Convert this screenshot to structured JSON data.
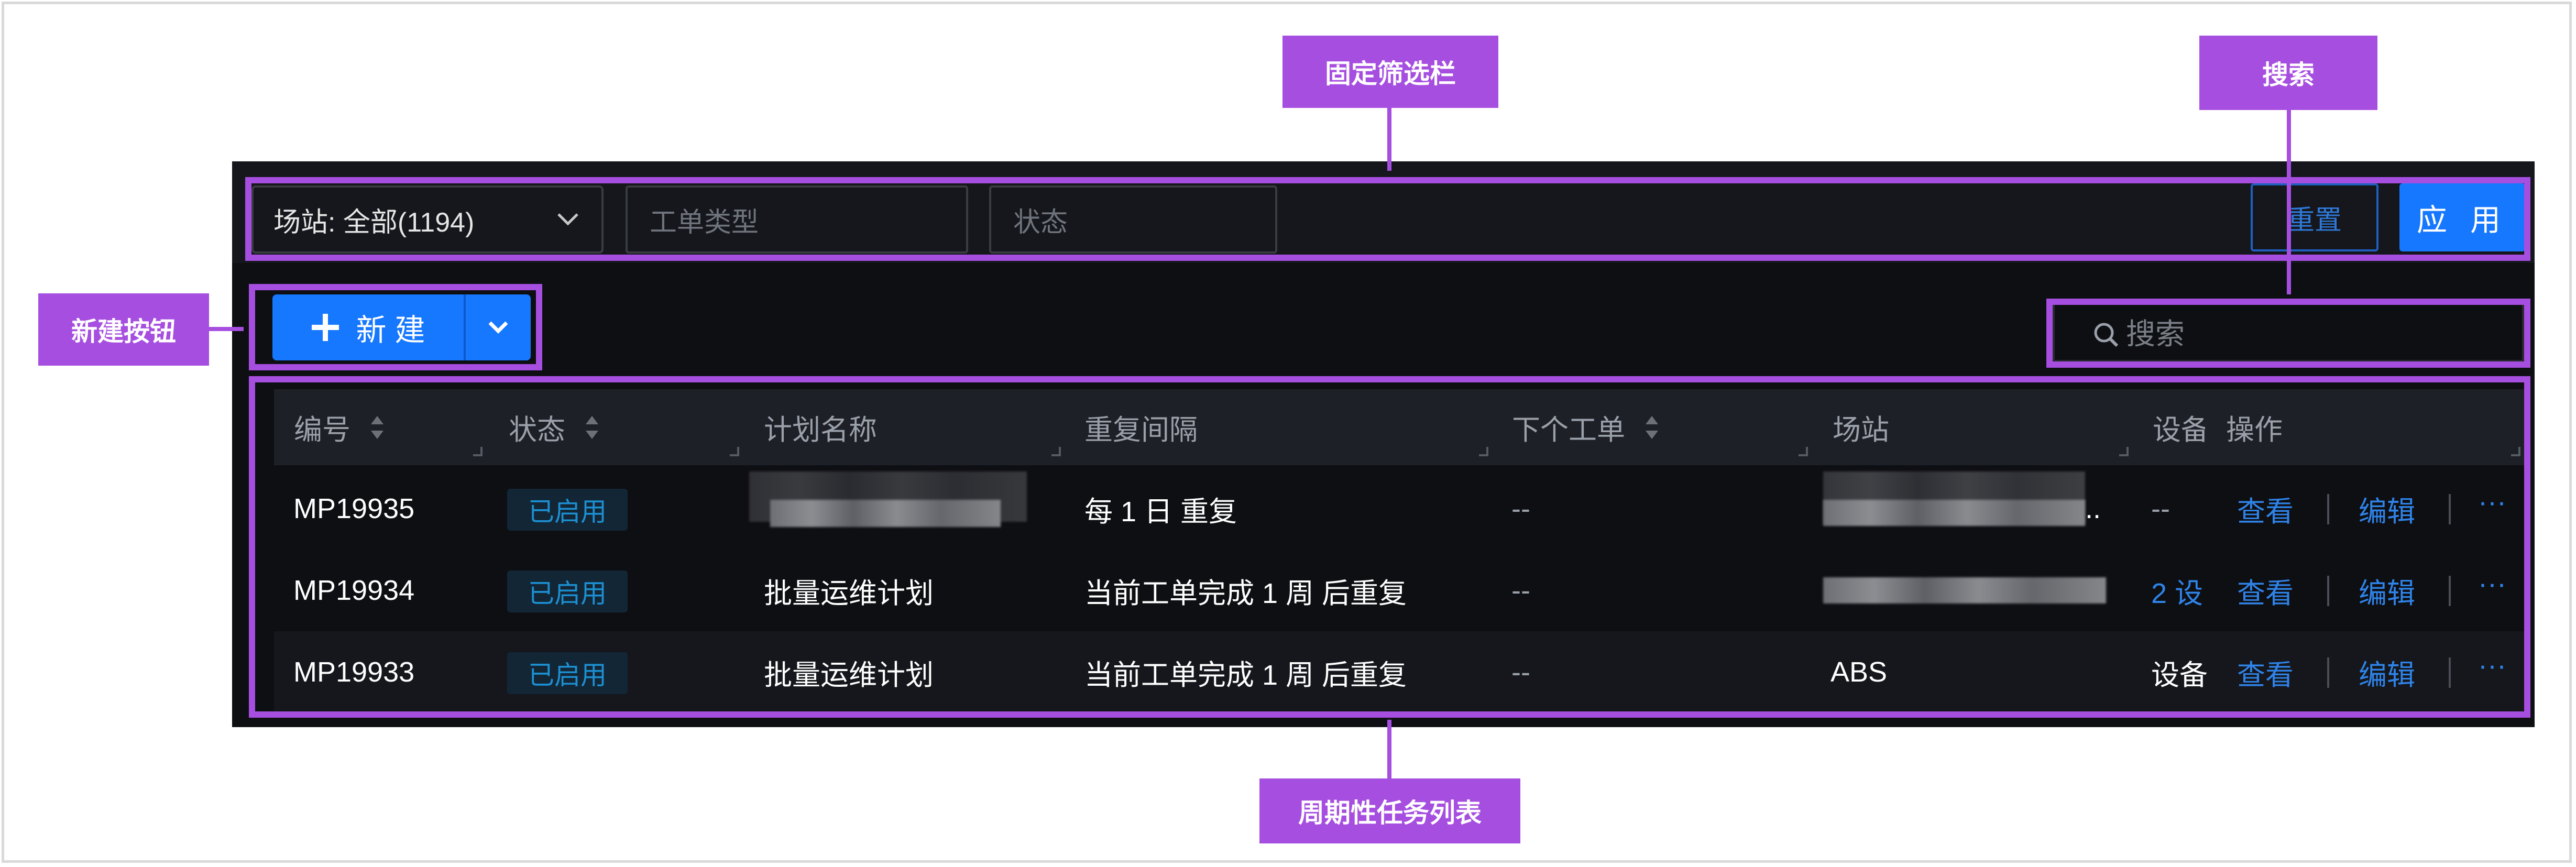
{
  "filter": {
    "site_select": "场站: 全部(1194)",
    "work_order_type_placeholder": "工单类型",
    "status_placeholder": "状态",
    "reset_label": "重置",
    "apply_label": "应 用"
  },
  "toolbar": {
    "new_label": "新 建",
    "search_placeholder": "搜索"
  },
  "table": {
    "columns": [
      "编号",
      "状态",
      "计划名称",
      "重复间隔",
      "下个工单",
      "场站",
      "设备",
      "操作"
    ],
    "rows": [
      {
        "id": "MP19935",
        "status": "已启用",
        "name": "",
        "repeat": "每 1 日 重复",
        "next": "--",
        "site": "",
        "device": "--"
      },
      {
        "id": "MP19934",
        "status": "已启用",
        "name": "批量运维计划",
        "repeat": "当前工单完成 1 周 后重复",
        "next": "--",
        "site": "",
        "device": "2 设"
      },
      {
        "id": "MP19933",
        "status": "已启用",
        "name": "批量运维计划",
        "repeat": "当前工单完成 1 周 后重复",
        "next": "--",
        "site": "ABS",
        "device": "设备"
      }
    ],
    "actions": {
      "view": "查看",
      "edit": "编辑",
      "more": "···"
    },
    "row0_site_ellipsis": ".."
  },
  "annotations": {
    "filter_bar": "固定筛选栏",
    "search": "搜索",
    "new_button": "新建按钮",
    "list": "周期性任务列表"
  },
  "colors": {
    "accent": "#1677ff",
    "annotation": "#a64ee0",
    "app_bg": "#0e0f13"
  }
}
